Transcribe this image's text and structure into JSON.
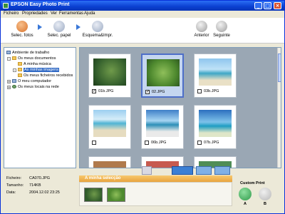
{
  "app": {
    "title": "EPSON Easy Photo Print"
  },
  "menu": {
    "items": [
      "Ficheiro",
      "Propriedades",
      "Ver",
      "Ferramentas",
      "Ajuda"
    ]
  },
  "toolbar": {
    "select_photos": "Selec. fotos",
    "select_paper": "Selec. papel",
    "layout_print": "Esquema&Impr.",
    "previous": "Anterior",
    "next": "Seguinte"
  },
  "tree": {
    "items": [
      {
        "label": "Ambiente de trabalho",
        "icon": "desktop-icon"
      },
      {
        "label": "Os meus documentos",
        "icon": "folder-icon"
      },
      {
        "label": "A minha música",
        "icon": "folder-icon"
      },
      {
        "label": "As minhas imagens",
        "icon": "folder-icon"
      },
      {
        "label": "Os meus ficheiros recebidos",
        "icon": "folder-icon"
      },
      {
        "label": "O meu computador",
        "icon": "computer-icon"
      },
      {
        "label": "Os meus locais na rede",
        "icon": "network-icon"
      }
    ]
  },
  "gallery": {
    "thumbnails": [
      {
        "filename": "01b.JPG",
        "checked": true,
        "selected": false
      },
      {
        "filename": "02.JPG",
        "checked": true,
        "selected": true
      },
      {
        "filename": "03b.JPG",
        "checked": false,
        "selected": false
      },
      {
        "filename": "",
        "checked": false,
        "selected": false
      },
      {
        "filename": "06b.JPG",
        "checked": false,
        "selected": false
      },
      {
        "filename": "07b.JPG",
        "checked": false,
        "selected": false
      }
    ]
  },
  "file_info": {
    "file_label": "Ficheiro:",
    "file_value": "CA070.JPG",
    "size_label": "Tamanho:",
    "size_value": "714KB",
    "date_label": "Data:",
    "date_value": "2004.12.02 23:25"
  },
  "selection": {
    "header": "A minha selecção"
  },
  "custom_print": {
    "title": "Custom Print",
    "a_label": "A",
    "b_label": "B"
  },
  "colors": {
    "titlebar": "#0a3fd0",
    "selection_header": "#e9a43e",
    "accent_green": "#2f9a4a"
  }
}
